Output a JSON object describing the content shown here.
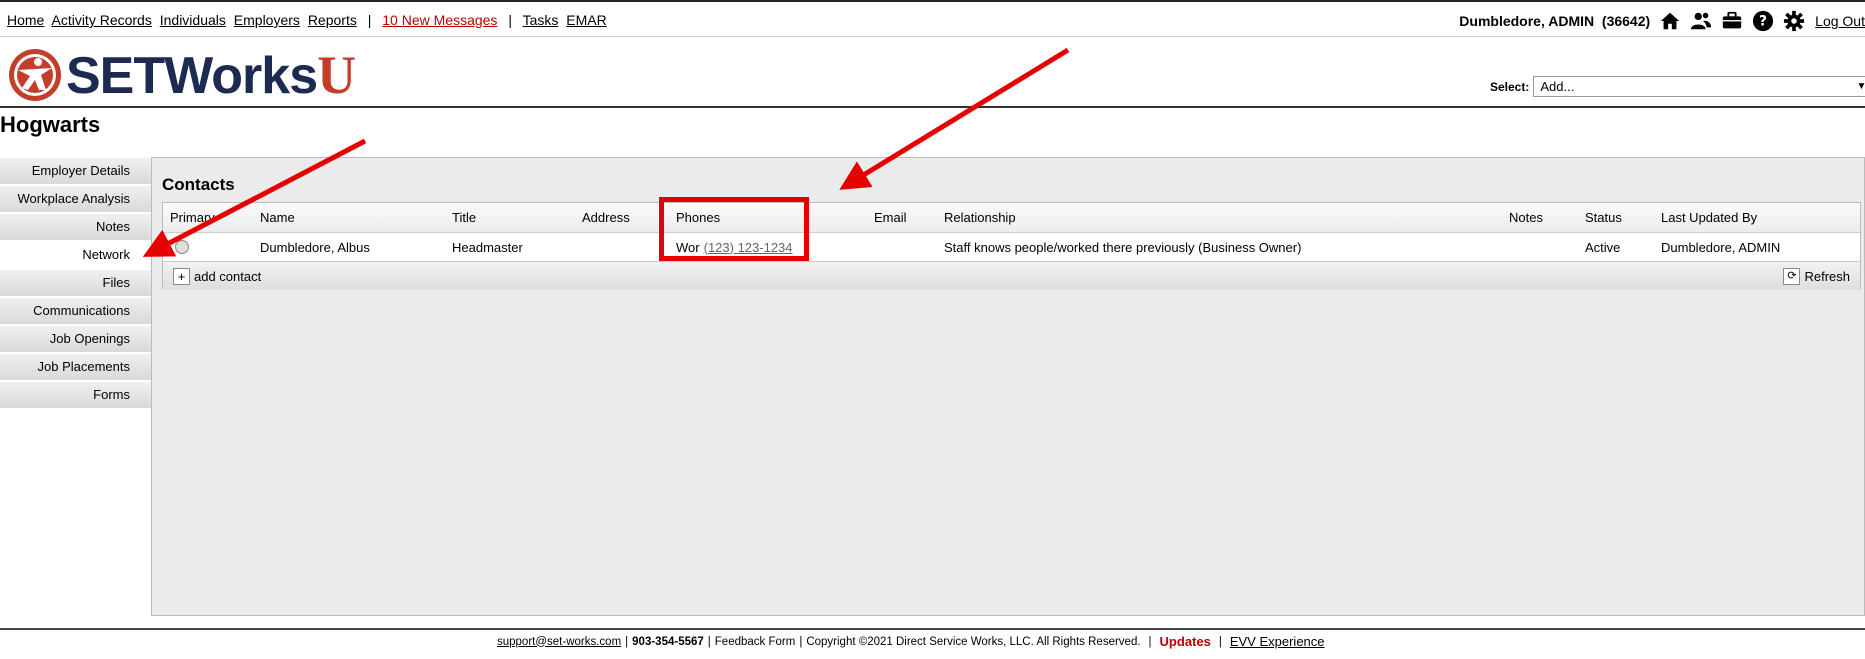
{
  "topnav": {
    "links": [
      "Home",
      "Activity Records",
      "Individuals",
      "Employers",
      "Reports"
    ],
    "sep": "|",
    "messages": "10 New Messages",
    "tasks": "Tasks",
    "emar": "EMAR"
  },
  "user": {
    "name": "Dumbledore, ADMIN",
    "id": "(36642)",
    "logout": "Log Out",
    "icons": [
      "home-icon",
      "users-icon",
      "briefcase-icon",
      "help-icon",
      "gear-icon"
    ]
  },
  "logo": {
    "word": "SETWorks",
    "letter": "U",
    "brand_red": "#c43d2b",
    "brand_navy": "#1d2a52"
  },
  "select": {
    "label": "Select:",
    "value": "Add..."
  },
  "page": {
    "title": "Hogwarts"
  },
  "sidebar": {
    "items": [
      {
        "label": "Employer Details"
      },
      {
        "label": "Workplace Analysis"
      },
      {
        "label": "Notes"
      },
      {
        "label": "Network",
        "active": true
      },
      {
        "label": "Files"
      },
      {
        "label": "Communications"
      },
      {
        "label": "Job Openings"
      },
      {
        "label": "Job Placements"
      },
      {
        "label": "Forms"
      }
    ]
  },
  "contacts": {
    "title": "Contacts",
    "columns": [
      "Primary",
      "Name",
      "Title",
      "Address",
      "Phones",
      "Email",
      "Relationship",
      "Notes",
      "Status",
      "Last Updated By"
    ],
    "rows": [
      {
        "name": "Dumbledore, Albus",
        "title": "Headmaster",
        "address": "",
        "phone_type": "Wor",
        "phone": "(123) 123-1234",
        "email": "",
        "relationship": "Staff knows people/worked there previously (Business Owner)",
        "notes": "",
        "status": "Active",
        "updated_by": "Dumbledore, ADMIN"
      }
    ],
    "add_label": "add contact",
    "refresh_label": "Refresh"
  },
  "footer": {
    "email": "support@set-works.com",
    "phone": "903-354-5567",
    "feedback": "Feedback Form",
    "copyright": "Copyright ©2021 Direct Service Works, LLC. All Rights Reserved.",
    "updates": "Updates",
    "evv": "EVV Experience",
    "sep": "|"
  },
  "annotation_color": "#e60000"
}
